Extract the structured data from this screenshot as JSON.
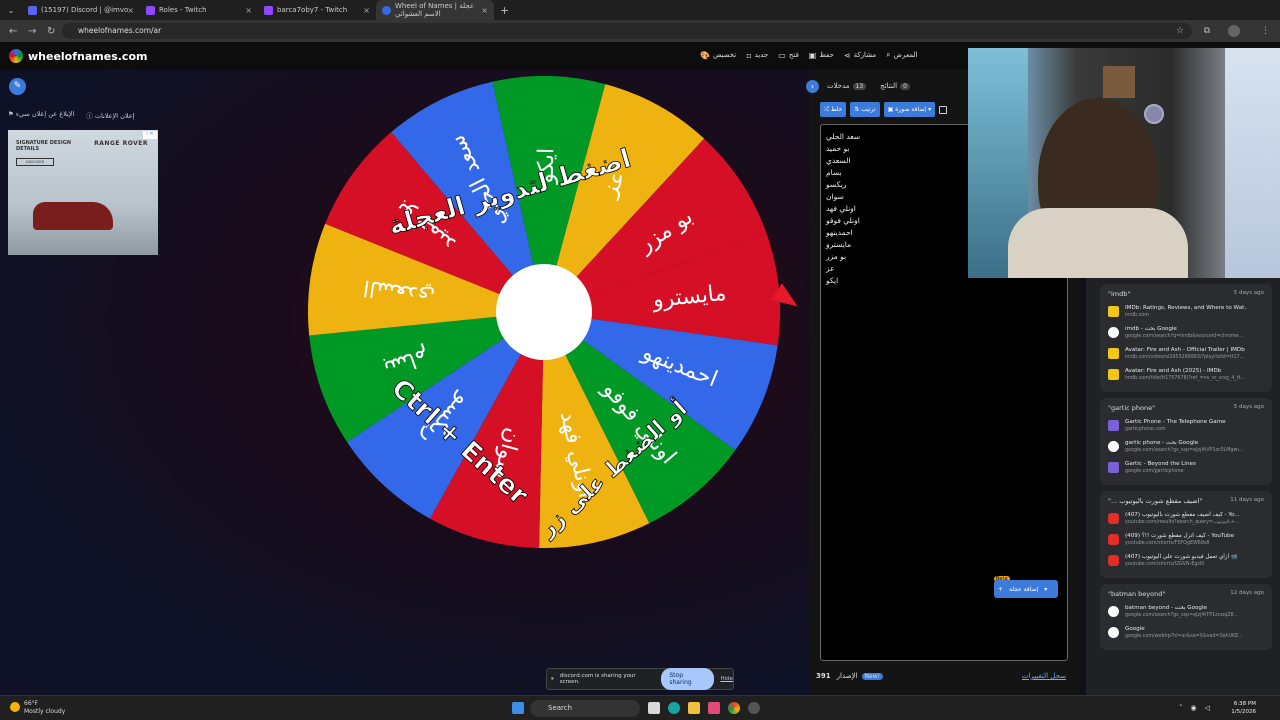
{
  "browser": {
    "tabs": [
      {
        "title": "(15197) Discord | @imvo",
        "color": "#5865f2"
      },
      {
        "title": "Roles - Twitch",
        "color": "#9146ff"
      },
      {
        "title": "barca7oby7 - Twitch",
        "color": "#9146ff"
      },
      {
        "title": "Wheel of Names | عجلة الاسم العشوائي",
        "color": "#3369e8"
      }
    ],
    "new_tab": "+",
    "url": "wheelofnames.com/ar"
  },
  "app": {
    "logo": "wheelofnames.com",
    "menu": [
      "تخصيص",
      "جديد",
      "فتح",
      "حفظ",
      "مشاركة",
      "المعرض"
    ]
  },
  "stage": {
    "ad_links": [
      "الإبلاغ عن إعلان سيء",
      "إعلان الإعلانات"
    ],
    "ad": {
      "headline": "SIGNATURE DESIGN DETAILS",
      "brand": "RANGE ROVER",
      "cta": "DISCOVER",
      "badge": "i ✕"
    }
  },
  "wheel": {
    "center_text": "اضغط لتدوير العجلة",
    "hint_text": "أو الضغط على زر",
    "shortcut": "Ctrl + Enter",
    "colors": [
      "#3369e8",
      "#009925",
      "#eeb211",
      "#d50f25"
    ],
    "labels": [
      "مايسترو",
      "احمدينهو",
      "اونلي فوفو",
      "اونلي فهد",
      "سوان",
      "ريكسو",
      "بسام",
      "السعدي",
      "بو حميد",
      "سعد الحلي",
      "ايكو",
      "عز",
      "بو مزر"
    ]
  },
  "panel": {
    "tab_entries": "مدخلات",
    "entries_count": "13",
    "tab_results": "النتائج",
    "results_count": "0",
    "buttons": [
      "خلط",
      "ترتيب",
      "إضافة صورة"
    ],
    "entries": [
      "سعد الحلي",
      "بو حميد",
      "السعدي",
      "بسام",
      "ريكسو",
      "سوان",
      "اونلي فهد",
      "اونلي فوفو",
      "احمدينهو",
      "مايسترو",
      "بو مزر",
      "عز",
      "ايكو"
    ],
    "beta": "Beta",
    "add_image": "إضافة عجلة",
    "version_label": "الإصدار",
    "version": "391",
    "new_badge": "New!",
    "changelog": "سجل التغييرات"
  },
  "history": [
    {
      "query": "\"imdb\"",
      "date": "5 days ago",
      "items": [
        {
          "title": "IMDb: Ratings, Reviews, and Where to Wat...",
          "url": "imdb.com",
          "icon": "imdb"
        },
        {
          "title": "imdb - بحث Google",
          "url": "google.com/search?q=imdb&sourceid=chrome...",
          "icon": "google"
        },
        {
          "title": "Avatar: Fire and Ash - Official Trailer | IMDb",
          "url": "imdb.com/video/vi2953299993/?playlistId=tt17...",
          "icon": "imdb"
        },
        {
          "title": "Avatar: Fire and Ash (2025) - IMDb",
          "url": "imdb.com/title/tt1757678/?ref_=nv_sr_srsg_4_tt...",
          "icon": "imdb"
        }
      ]
    },
    {
      "query": "\"gartic phone\"",
      "date": "5 days ago",
      "items": [
        {
          "title": "Gartic Phone - The Telephone Game",
          "url": "garticphone.com",
          "icon": "gartic"
        },
        {
          "title": "gartic phone - بحث Google",
          "url": "google.com/search?gs_ssp=eJzj4tVP1zc0LMgwi...",
          "icon": "google"
        },
        {
          "title": "Gartic - Beyond the Lines",
          "url": "google.com/garticphone",
          "icon": "gartic"
        }
      ]
    },
    {
      "query": "\"... اضيف مقطع شورت باليوتيوب\"",
      "date": "11 days ago",
      "items": [
        {
          "title": "(407) كيف اضيف مقطع شورت باليوتيوب - Yo...",
          "url": "youtube.com/results?search_query=باليوتيوب+...",
          "icon": "youtube"
        },
        {
          "title": "(409) كيف انزل مقطع شورت !!؟ - YouTube",
          "url": "youtube.com/shorts/F5FOgEW69s8",
          "icon": "youtube"
        },
        {
          "title": "(407) ازاي تعمل فيديو شورت علي اليوتيوب 📹",
          "url": "youtube.com/shorts/I2GVN-Egzl0",
          "icon": "youtube"
        }
      ]
    },
    {
      "query": "\"batman beyond\"",
      "date": "12 days ago",
      "items": [
        {
          "title": "batman beyond - بحث Google",
          "url": "google.com/search?gs_ssp=eJzj4tTP1zcwqZ8...",
          "icon": "google"
        },
        {
          "title": "Google",
          "url": "google.com/webhp?hl=ar&sa=X&ved=0ahUKE...",
          "icon": "google"
        }
      ]
    }
  ],
  "share_bar": {
    "text": "discord.com is sharing your screen.",
    "stop": "Stop sharing",
    "hide": "Hide"
  },
  "taskbar": {
    "temp": "66°F",
    "weather": "Mostly cloudy",
    "search": "Search",
    "time": "6:38 PM",
    "date": "1/5/2026"
  }
}
